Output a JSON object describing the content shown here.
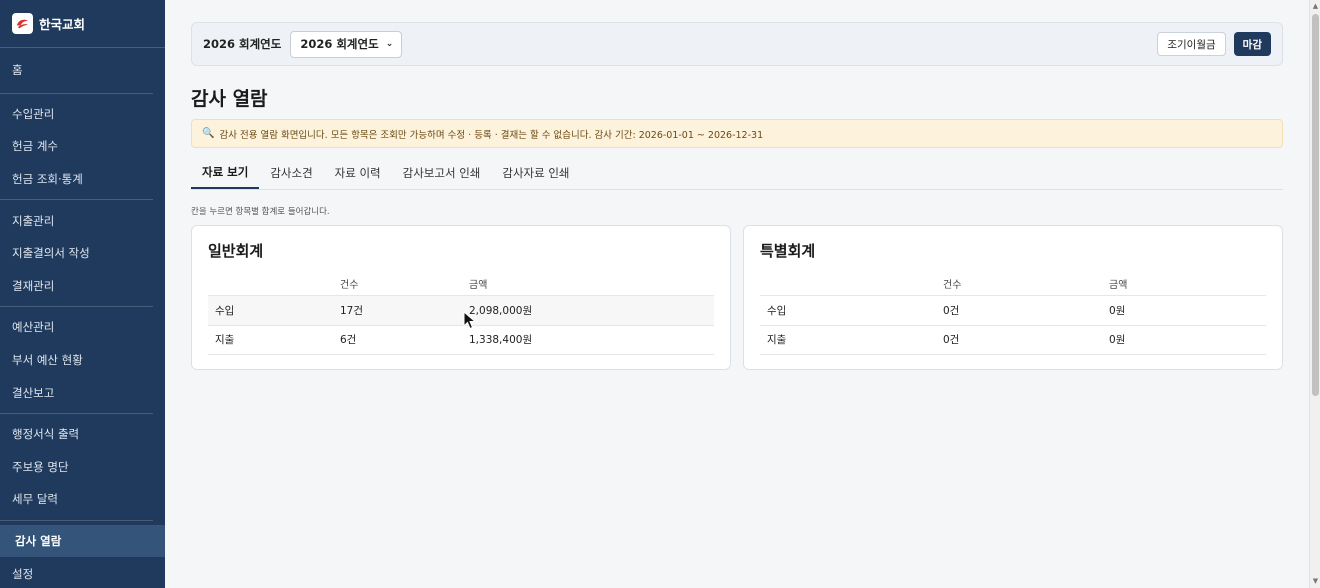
{
  "brand": {
    "name": "한국교회",
    "logo_icon": "church-logo-icon"
  },
  "sidebar": {
    "groups": [
      {
        "items": [
          {
            "label": "홈"
          }
        ]
      },
      {
        "items": [
          {
            "label": "수입관리"
          },
          {
            "label": "헌금 계수"
          },
          {
            "label": "헌금 조회·통계"
          }
        ]
      },
      {
        "items": [
          {
            "label": "지출관리"
          },
          {
            "label": "지출결의서 작성"
          },
          {
            "label": "결재관리"
          }
        ]
      },
      {
        "items": [
          {
            "label": "예산관리"
          },
          {
            "label": "부서 예산 현황"
          },
          {
            "label": "결산보고"
          }
        ]
      },
      {
        "items": [
          {
            "label": "행정서식 출력"
          },
          {
            "label": "주보용 명단"
          },
          {
            "label": "세무 달력"
          }
        ]
      },
      {
        "items": [
          {
            "label": "감사 열람",
            "active": true
          },
          {
            "label": "설정"
          }
        ]
      }
    ]
  },
  "topbar": {
    "fiscal_year_label": "2026 회계연도",
    "fiscal_year_selected": "2026 회계연도",
    "opening_balance_button": "조기이월금",
    "close_button": "마감"
  },
  "page": {
    "title": "감사 열람",
    "notice": "감사 전용 열람 화면입니다. 모든 항목은 조회만 가능하며 수정 · 등록 · 결재는 할 수 없습니다. 감사 기간: 2026-01-01 ~ 2026-12-31",
    "hint": "칸을 누르면 항목별 합계로 들어갑니다."
  },
  "tabs": [
    {
      "label": "자료 보기",
      "active": true
    },
    {
      "label": "감사소견"
    },
    {
      "label": "자료 이력"
    },
    {
      "label": "감사보고서 인쇄"
    },
    {
      "label": "감사자료 인쇄"
    }
  ],
  "cards": [
    {
      "title": "일반회계",
      "headers": [
        "",
        "건수",
        "금액"
      ],
      "rows": [
        {
          "type": "수입",
          "count": "17건",
          "amount": "2,098,000원"
        },
        {
          "type": "지출",
          "count": "6건",
          "amount": "1,338,400원"
        }
      ]
    },
    {
      "title": "특별회계",
      "headers": [
        "",
        "건수",
        "금액"
      ],
      "rows": [
        {
          "type": "수입",
          "count": "0건",
          "amount": "0원"
        },
        {
          "type": "지출",
          "count": "0건",
          "amount": "0원"
        }
      ]
    }
  ],
  "colors": {
    "sidebar_bg": "#1f3a5c",
    "accent": "#1f3a5c",
    "notice_bg": "#fdf2dc"
  }
}
